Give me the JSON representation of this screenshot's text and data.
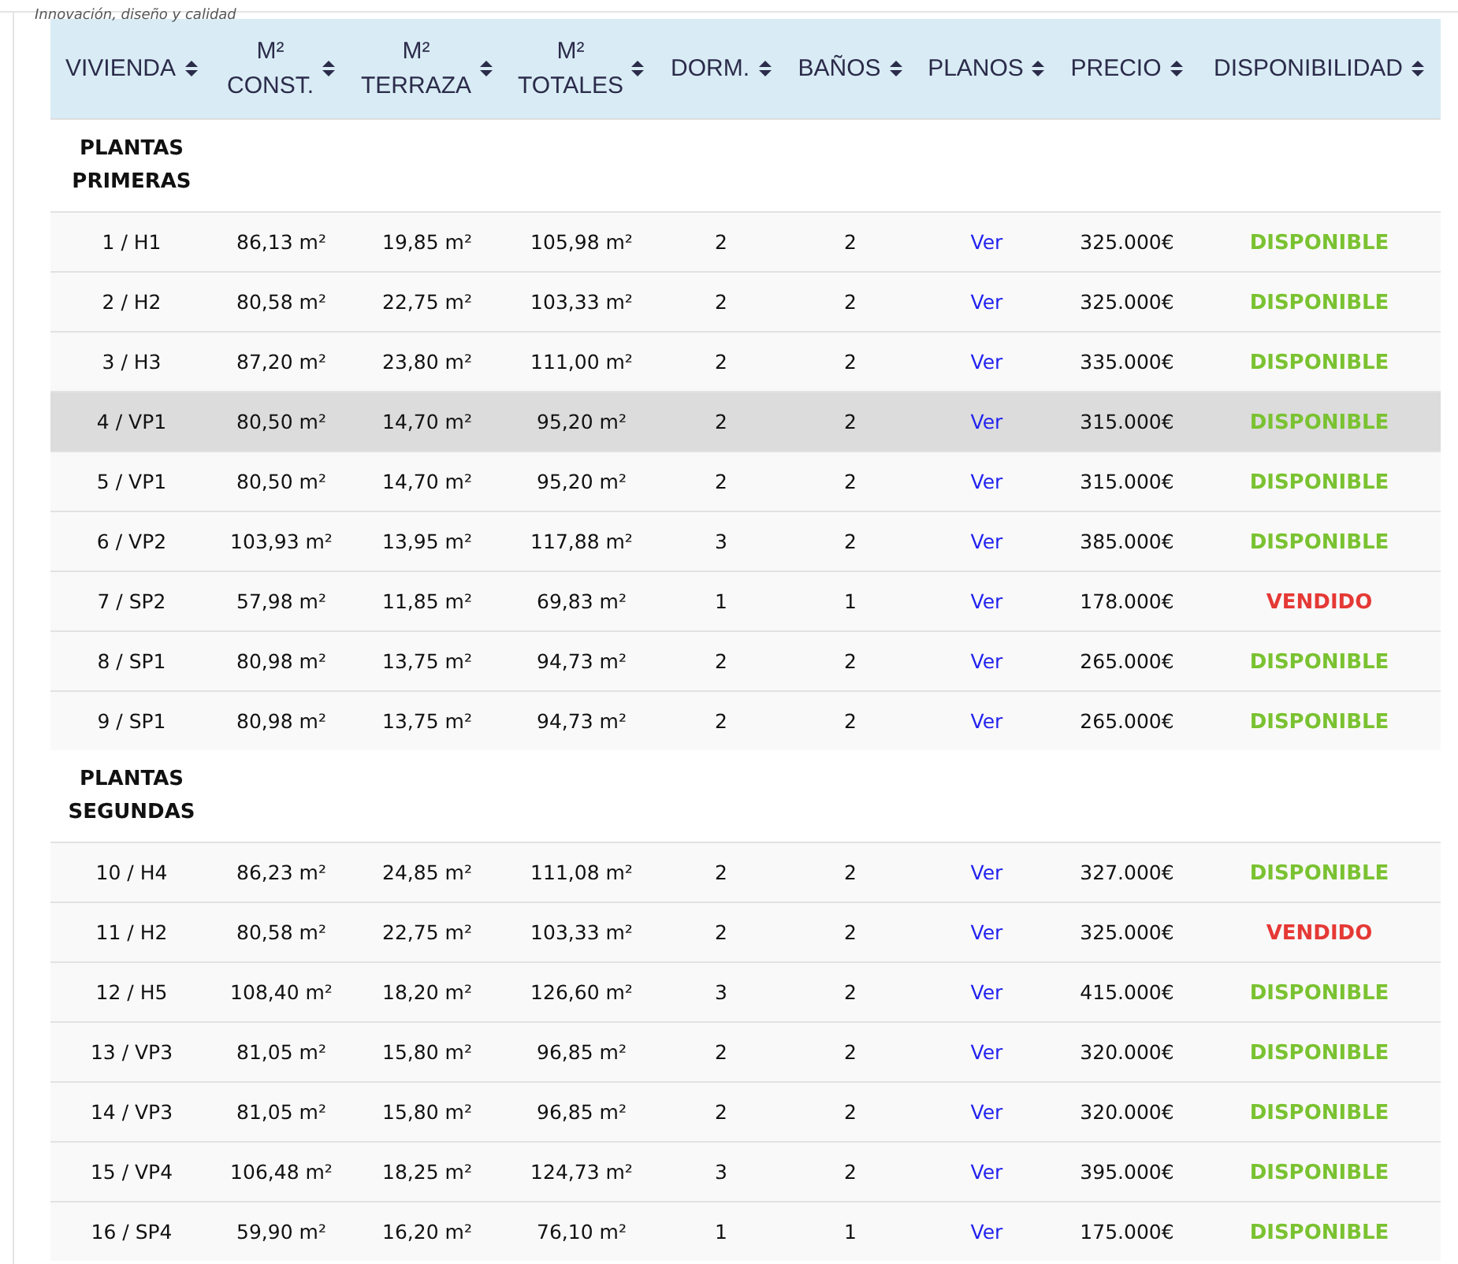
{
  "tagline": "Innovación, diseño y calidad",
  "columns": [
    "VIVIENDA",
    "M² CONST.",
    "M² TERRAZA",
    "M² TOTALES",
    "DORM.",
    "BAÑOS",
    "PLANOS",
    "PRECIO",
    "DISPONIBILIDAD"
  ],
  "sections": [
    {
      "title": "PLANTAS PRIMERAS",
      "rows": [
        {
          "vivienda": "1 / H1",
          "const": "86,13 m²",
          "terraza": "19,85 m²",
          "totales": "105,98 m²",
          "dorm": "2",
          "banos": "2",
          "planos": "Ver",
          "precio": "325.000€",
          "status": {
            "kind": "available",
            "label": "DISPONIBLE"
          },
          "hovered": false
        },
        {
          "vivienda": "2 / H2",
          "const": "80,58 m²",
          "terraza": "22,75 m²",
          "totales": "103,33 m²",
          "dorm": "2",
          "banos": "2",
          "planos": "Ver",
          "precio": "325.000€",
          "status": {
            "kind": "available",
            "label": "DISPONIBLE"
          },
          "hovered": false
        },
        {
          "vivienda": "3 / H3",
          "const": "87,20 m²",
          "terraza": "23,80 m²",
          "totales": "111,00 m²",
          "dorm": "2",
          "banos": "2",
          "planos": "Ver",
          "precio": "335.000€",
          "status": {
            "kind": "available",
            "label": "DISPONIBLE"
          },
          "hovered": false
        },
        {
          "vivienda": "4 / VP1",
          "const": "80,50 m²",
          "terraza": "14,70 m²",
          "totales": "95,20 m²",
          "dorm": "2",
          "banos": "2",
          "planos": "Ver",
          "precio": "315.000€",
          "status": {
            "kind": "available",
            "label": "DISPONIBLE"
          },
          "hovered": true
        },
        {
          "vivienda": "5 / VP1",
          "const": "80,50 m²",
          "terraza": "14,70 m²",
          "totales": "95,20 m²",
          "dorm": "2",
          "banos": "2",
          "planos": "Ver",
          "precio": "315.000€",
          "status": {
            "kind": "available",
            "label": "DISPONIBLE"
          },
          "hovered": false
        },
        {
          "vivienda": "6 / VP2",
          "const": "103,93 m²",
          "terraza": "13,95 m²",
          "totales": "117,88 m²",
          "dorm": "3",
          "banos": "2",
          "planos": "Ver",
          "precio": "385.000€",
          "status": {
            "kind": "available",
            "label": "DISPONIBLE"
          },
          "hovered": false
        },
        {
          "vivienda": "7 / SP2",
          "const": "57,98 m²",
          "terraza": "11,85 m²",
          "totales": "69,83 m²",
          "dorm": "1",
          "banos": "1",
          "planos": "Ver",
          "precio": "178.000€",
          "status": {
            "kind": "sold",
            "label": "VENDIDO"
          },
          "hovered": false
        },
        {
          "vivienda": "8 / SP1",
          "const": "80,98 m²",
          "terraza": "13,75 m²",
          "totales": "94,73 m²",
          "dorm": "2",
          "banos": "2",
          "planos": "Ver",
          "precio": "265.000€",
          "status": {
            "kind": "available",
            "label": "DISPONIBLE"
          },
          "hovered": false
        },
        {
          "vivienda": "9 / SP1",
          "const": "80,98 m²",
          "terraza": "13,75 m²",
          "totales": "94,73 m²",
          "dorm": "2",
          "banos": "2",
          "planos": "Ver",
          "precio": "265.000€",
          "status": {
            "kind": "available",
            "label": "DISPONIBLE"
          },
          "hovered": false
        }
      ]
    },
    {
      "title": "PLANTAS SEGUNDAS",
      "rows": [
        {
          "vivienda": "10 / H4",
          "const": "86,23 m²",
          "terraza": "24,85 m²",
          "totales": "111,08 m²",
          "dorm": "2",
          "banos": "2",
          "planos": "Ver",
          "precio": "327.000€",
          "status": {
            "kind": "available",
            "label": "DISPONIBLE"
          },
          "hovered": false
        },
        {
          "vivienda": "11 / H2",
          "const": "80,58 m²",
          "terraza": "22,75 m²",
          "totales": "103,33 m²",
          "dorm": "2",
          "banos": "2",
          "planos": "Ver",
          "precio": "325.000€",
          "status": {
            "kind": "sold",
            "label": "VENDIDO"
          },
          "hovered": false
        },
        {
          "vivienda": "12 / H5",
          "const": "108,40 m²",
          "terraza": "18,20 m²",
          "totales": "126,60 m²",
          "dorm": "3",
          "banos": "2",
          "planos": "Ver",
          "precio": "415.000€",
          "status": {
            "kind": "available",
            "label": "DISPONIBLE"
          },
          "hovered": false
        },
        {
          "vivienda": "13 / VP3",
          "const": "81,05 m²",
          "terraza": "15,80 m²",
          "totales": "96,85 m²",
          "dorm": "2",
          "banos": "2",
          "planos": "Ver",
          "precio": "320.000€",
          "status": {
            "kind": "available",
            "label": "DISPONIBLE"
          },
          "hovered": false
        },
        {
          "vivienda": "14 / VP3",
          "const": "81,05 m²",
          "terraza": "15,80 m²",
          "totales": "96,85 m²",
          "dorm": "2",
          "banos": "2",
          "planos": "Ver",
          "precio": "320.000€",
          "status": {
            "kind": "available",
            "label": "DISPONIBLE"
          },
          "hovered": false
        },
        {
          "vivienda": "15 / VP4",
          "const": "106,48 m²",
          "terraza": "18,25 m²",
          "totales": "124,73 m²",
          "dorm": "3",
          "banos": "2",
          "planos": "Ver",
          "precio": "395.000€",
          "status": {
            "kind": "available",
            "label": "DISPONIBLE"
          },
          "hovered": false
        },
        {
          "vivienda": "16 / SP4",
          "const": "59,90 m²",
          "terraza": "16,20 m²",
          "totales": "76,10 m²",
          "dorm": "1",
          "banos": "1",
          "planos": "Ver",
          "precio": "175.000€",
          "status": {
            "kind": "available",
            "label": "DISPONIBLE"
          },
          "hovered": false
        }
      ]
    }
  ]
}
